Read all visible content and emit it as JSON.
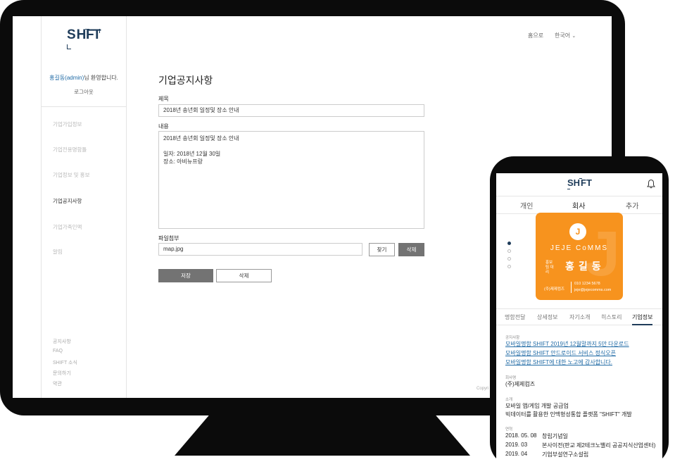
{
  "desktop": {
    "logo": "SHFT",
    "welcome_user": "홍길동(admin)",
    "welcome_suffix": "님 환영합니다.",
    "logout": "로그아웃",
    "nav": [
      "기업가입정보",
      "기업전용명함틀",
      "기업정보 및 홍보",
      "기업공지사항",
      "기업가족인맥",
      "알림"
    ],
    "active_nav": "기업공지사항",
    "footer_links": [
      "공지사항",
      "FAQ",
      "SHIFT 소식",
      "문의하기",
      "약관"
    ],
    "topbar": {
      "home": "홈으로",
      "language": "한국어"
    },
    "page_title": "기업공지사항",
    "form": {
      "title_label": "제목",
      "title_value": "2018년 송년회 일정및 장소 안내",
      "content_label": "내용",
      "content_lines": [
        "2018년 송년회 일정및 장소 안내",
        "",
        "일자: 2018년 12월 30일",
        "장소: 아비뉴프랑"
      ],
      "attach_label": "파일첨부",
      "attach_value": "map.jpg",
      "find_button": "찾기",
      "delete_file_button": "삭제",
      "save_button": "저장",
      "delete_button": "삭제"
    },
    "copyright": "Copyri"
  },
  "phone": {
    "logo": "SHFT",
    "top_tabs": [
      "개인",
      "회사",
      "추가"
    ],
    "active_top_tab": "회사",
    "card": {
      "brand": "JEJE CoMMS",
      "role": "홍보팀 대리",
      "name": "홍길동",
      "company": "(주)제제컴즈",
      "phone": "010 1234 5678",
      "email": "jeje@jejecomms.com",
      "color": "#f7931e"
    },
    "mid_tabs": [
      "명함전달",
      "상세정보",
      "자기소개",
      "히스토리",
      "기업정보"
    ],
    "active_mid_tab": "기업정보",
    "notice_label": "공지사항",
    "notices": [
      "모바일명함 SHIFT 2019년 12월말까지 5만 다운로드",
      "모바일명함 SHIFT 안드로이드 서비스 정식오픈",
      "모바일명함 SHIFT에 대한 노고에 감사합니다."
    ],
    "company_label": "회사명",
    "company_name": "(주)제제컴즈",
    "intro_label": "소개",
    "intro_lines": [
      "모바일 앱/게임 개발 공급업",
      "빅데이터를 활용한 인맥형성통합 플랫폼 \"SHIFT\" 개발"
    ],
    "history_label": "연혁",
    "history": [
      {
        "date": "2018. 05. 08",
        "text": "창립기념일"
      },
      {
        "date": "2019. 03",
        "text": "본사이전(판교 제2테크노밸리 공공지식산업센터)"
      },
      {
        "date": "2019. 04",
        "text": "기업부설연구소설립"
      }
    ]
  }
}
